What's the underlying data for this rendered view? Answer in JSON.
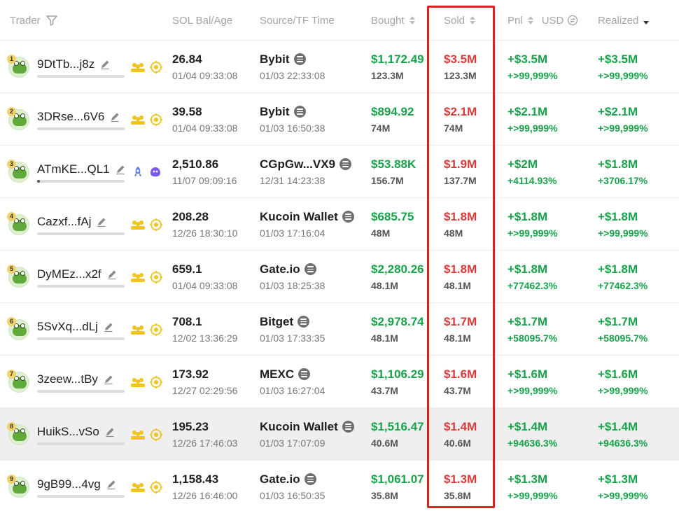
{
  "headers": {
    "trader": "Trader",
    "sol_bal_age": "SOL Bal/Age",
    "source_tf_time": "Source/TF Time",
    "bought": "Bought",
    "sold": "Sold",
    "pnl": "Pnl",
    "usd": "USD",
    "realized": "Realized"
  },
  "colors": {
    "green": "#17a34a",
    "red": "#d93a3a",
    "highlight_box": "#e02020"
  },
  "rows": [
    {
      "rank": "1",
      "trader": "9DtTb...j8z",
      "bal": "26.84",
      "age": "01/04 09:33:08",
      "source": "Bybit",
      "tf_time": "01/03 22:33:08",
      "bought_usd": "$1,172.49",
      "bought_amt": "123.3M",
      "sold_usd": "$3.5M",
      "sold_amt": "123.3M",
      "pnl": "+$3.5M",
      "pnl_pct": "+>99,999%",
      "realized": "+$3.5M",
      "realized_pct": "+>99,999%",
      "badges": [
        "group-icon",
        "target-icon"
      ],
      "bar_fill": 0
    },
    {
      "rank": "2",
      "trader": "3DRse...6V6",
      "bal": "39.58",
      "age": "01/04 09:33:08",
      "source": "Bybit",
      "tf_time": "01/03 16:50:38",
      "bought_usd": "$894.92",
      "bought_amt": "74M",
      "sold_usd": "$2.1M",
      "sold_amt": "74M",
      "pnl": "+$2.1M",
      "pnl_pct": "+>99,999%",
      "realized": "+$2.1M",
      "realized_pct": "+>99,999%",
      "badges": [
        "group-icon",
        "target-icon"
      ],
      "bar_fill": 0
    },
    {
      "rank": "3",
      "trader": "ATmKE...QL1",
      "bal": "2,510.86",
      "age": "11/07 09:09:16",
      "source": "CGpGw...VX9",
      "tf_time": "12/31 14:23:38",
      "bought_usd": "$53.88K",
      "bought_amt": "156.7M",
      "sold_usd": "$1.9M",
      "sold_amt": "137.7M",
      "pnl": "+$2M",
      "pnl_pct": "+4114.93%",
      "realized": "+$1.8M",
      "realized_pct": "+3706.17%",
      "badges": [
        "rocket-icon",
        "ghost-icon"
      ],
      "bar_fill": 0.03
    },
    {
      "rank": "4",
      "trader": "Cazxf...fAj",
      "bal": "208.28",
      "age": "12/26 18:30:10",
      "source": "Kucoin Wallet",
      "tf_time": "01/03 17:16:04",
      "bought_usd": "$685.75",
      "bought_amt": "48M",
      "sold_usd": "$1.8M",
      "sold_amt": "48M",
      "pnl": "+$1.8M",
      "pnl_pct": "+>99,999%",
      "realized": "+$1.8M",
      "realized_pct": "+>99,999%",
      "badges": [
        "group-icon",
        "target-icon"
      ],
      "bar_fill": 0
    },
    {
      "rank": "5",
      "trader": "DyMEz...x2f",
      "bal": "659.1",
      "age": "01/04 09:33:08",
      "source": "Gate.io",
      "tf_time": "01/03 18:25:38",
      "bought_usd": "$2,280.26",
      "bought_amt": "48.1M",
      "sold_usd": "$1.8M",
      "sold_amt": "48.1M",
      "pnl": "+$1.8M",
      "pnl_pct": "+77462.3%",
      "realized": "+$1.8M",
      "realized_pct": "+77462.3%",
      "badges": [
        "group-icon",
        "target-icon"
      ],
      "bar_fill": 0
    },
    {
      "rank": "6",
      "trader": "5SvXq...dLj",
      "bal": "708.1",
      "age": "12/02 13:36:29",
      "source": "Bitget",
      "tf_time": "01/03 17:33:35",
      "bought_usd": "$2,978.74",
      "bought_amt": "48.1M",
      "sold_usd": "$1.7M",
      "sold_amt": "48.1M",
      "pnl": "+$1.7M",
      "pnl_pct": "+58095.7%",
      "realized": "+$1.7M",
      "realized_pct": "+58095.7%",
      "badges": [
        "group-icon",
        "target-icon"
      ],
      "bar_fill": 0
    },
    {
      "rank": "7",
      "trader": "3zeew...tBy",
      "bal": "173.92",
      "age": "12/27 02:29:56",
      "source": "MEXC",
      "tf_time": "01/03 16:27:04",
      "bought_usd": "$1,106.29",
      "bought_amt": "43.7M",
      "sold_usd": "$1.6M",
      "sold_amt": "43.7M",
      "pnl": "+$1.6M",
      "pnl_pct": "+>99,999%",
      "realized": "+$1.6M",
      "realized_pct": "+>99,999%",
      "badges": [
        "group-icon",
        "target-icon"
      ],
      "bar_fill": 0
    },
    {
      "rank": "8",
      "trader": "HuikS...vSo",
      "bal": "195.23",
      "age": "12/26 17:46:03",
      "source": "Kucoin Wallet",
      "tf_time": "01/03 17:07:09",
      "bought_usd": "$1,516.47",
      "bought_amt": "40.6M",
      "sold_usd": "$1.4M",
      "sold_amt": "40.6M",
      "pnl": "+$1.4M",
      "pnl_pct": "+94636.3%",
      "realized": "+$1.4M",
      "realized_pct": "+94636.3%",
      "badges": [
        "group-icon",
        "target-icon"
      ],
      "bar_fill": 0
    },
    {
      "rank": "9",
      "trader": "9gB99...4vg",
      "bal": "1,158.43",
      "age": "12/26 16:46:00",
      "source": "Gate.io",
      "tf_time": "01/03 16:50:35",
      "bought_usd": "$1,061.07",
      "bought_amt": "35.8M",
      "sold_usd": "$1.3M",
      "sold_amt": "35.8M",
      "pnl": "+$1.3M",
      "pnl_pct": "+>99,999%",
      "realized": "+$1.3M",
      "realized_pct": "+>99,999%",
      "badges": [
        "group-icon",
        "target-icon"
      ],
      "bar_fill": 0
    }
  ]
}
